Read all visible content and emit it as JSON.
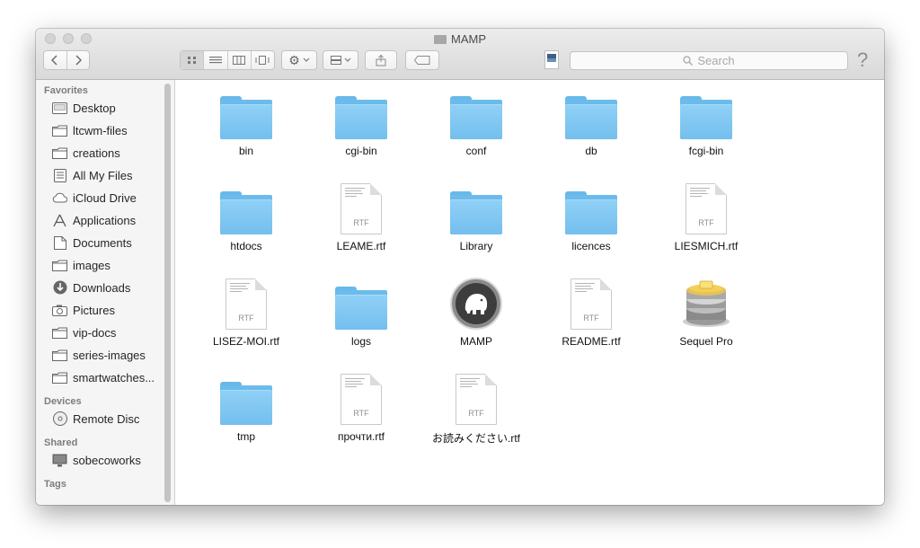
{
  "window": {
    "title": "MAMP"
  },
  "toolbar": {
    "search_placeholder": "Search",
    "help_label": "?"
  },
  "sidebar": {
    "sections": [
      {
        "heading": "Favorites",
        "items": [
          {
            "label": "Desktop",
            "icon": "desktop-icon"
          },
          {
            "label": "ltcwm-files",
            "icon": "folder-icon"
          },
          {
            "label": "creations",
            "icon": "folder-icon"
          },
          {
            "label": "All My Files",
            "icon": "all-files-icon"
          },
          {
            "label": "iCloud Drive",
            "icon": "cloud-icon"
          },
          {
            "label": "Applications",
            "icon": "applications-icon"
          },
          {
            "label": "Documents",
            "icon": "documents-icon"
          },
          {
            "label": "images",
            "icon": "folder-icon"
          },
          {
            "label": "Downloads",
            "icon": "download-icon"
          },
          {
            "label": "Pictures",
            "icon": "camera-icon"
          },
          {
            "label": "vip-docs",
            "icon": "folder-icon"
          },
          {
            "label": "series-images",
            "icon": "folder-icon"
          },
          {
            "label": "smartwatches...",
            "icon": "folder-icon"
          }
        ]
      },
      {
        "heading": "Devices",
        "items": [
          {
            "label": "Remote Disc",
            "icon": "disc-icon"
          }
        ]
      },
      {
        "heading": "Shared",
        "items": [
          {
            "label": "sobecoworks",
            "icon": "computer-icon"
          }
        ]
      },
      {
        "heading": "Tags",
        "items": []
      }
    ]
  },
  "files": [
    {
      "name": "bin",
      "kind": "folder"
    },
    {
      "name": "cgi-bin",
      "kind": "folder"
    },
    {
      "name": "conf",
      "kind": "folder"
    },
    {
      "name": "db",
      "kind": "folder"
    },
    {
      "name": "fcgi-bin",
      "kind": "folder"
    },
    {
      "name": "htdocs",
      "kind": "folder"
    },
    {
      "name": "LEAME.rtf",
      "kind": "rtf",
      "ext": "RTF"
    },
    {
      "name": "Library",
      "kind": "folder"
    },
    {
      "name": "licences",
      "kind": "folder"
    },
    {
      "name": "LIESMICH.rtf",
      "kind": "rtf",
      "ext": "RTF"
    },
    {
      "name": "LISEZ-MOI.rtf",
      "kind": "rtf",
      "ext": "RTF"
    },
    {
      "name": "logs",
      "kind": "folder"
    },
    {
      "name": "MAMP",
      "kind": "app-mamp"
    },
    {
      "name": "README.rtf",
      "kind": "rtf",
      "ext": "RTF"
    },
    {
      "name": "Sequel Pro",
      "kind": "app-sequel"
    },
    {
      "name": "tmp",
      "kind": "folder"
    },
    {
      "name": "прочти.rtf",
      "kind": "rtf",
      "ext": "RTF"
    },
    {
      "name": "お読みください.rtf",
      "kind": "rtf",
      "ext": "RTF"
    }
  ],
  "colors": {
    "folder_blue": "#74bfee",
    "sidebar_bg": "#f5f5f5"
  }
}
